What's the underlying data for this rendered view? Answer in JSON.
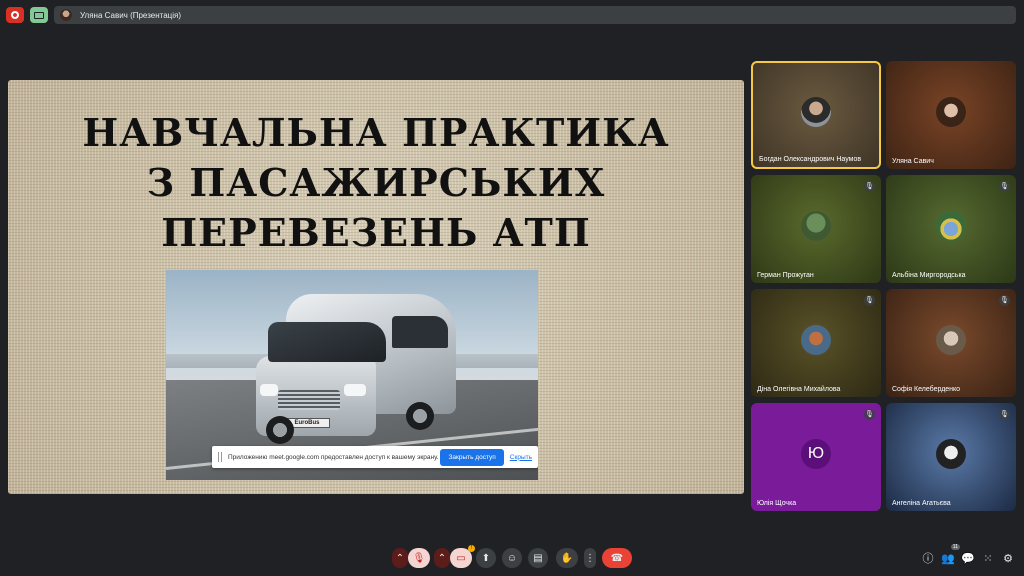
{
  "topbar": {
    "presenter_label": "Уляна Савич (Презентація)"
  },
  "slide": {
    "title_lines": [
      "НАВЧАЛЬНА ПРАКТИКА",
      "З ПАСАЖИРСЬКИХ",
      "ПЕРЕВЕЗЕНЬ АТП"
    ],
    "van_plate": "EuroBus"
  },
  "share_notice": {
    "text": "Приложению meet.google.com предоставлен доступ к вашему экрану.",
    "stop_label": "Закрыть доступ",
    "hide_label": "Скрыть"
  },
  "participants": [
    {
      "name": "Богдан Олександрович Наумов",
      "muted": false,
      "active": true,
      "bg": "#5a4a33"
    },
    {
      "name": "Уляна Савич",
      "muted": false,
      "active": false,
      "bg": "#5b3320"
    },
    {
      "name": "Герман Прожуган",
      "muted": true,
      "active": false,
      "bg": "#3c4a1f"
    },
    {
      "name": "Альбіна Миргородська",
      "muted": true,
      "active": false,
      "bg": "#3d4a22"
    },
    {
      "name": "Діна Олегівна Михайлова",
      "muted": true,
      "active": false,
      "bg": "#3f3a1c"
    },
    {
      "name": "Софія Келеберденко",
      "muted": true,
      "active": false,
      "bg": "#5a3620"
    },
    {
      "name": "Юлія Щочка",
      "muted": true,
      "active": false,
      "bg": "#7a1b9a",
      "initial": "Ю"
    },
    {
      "name": "Ангеліна Агатьєва",
      "muted": true,
      "active": false,
      "bg": "#2a3e5e"
    }
  ],
  "controls": {
    "people_count": "11"
  }
}
